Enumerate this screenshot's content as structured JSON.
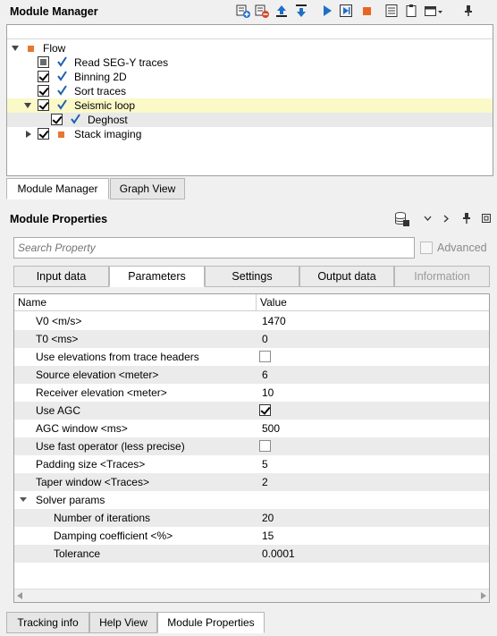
{
  "module_manager": {
    "title": "Module Manager",
    "toolbar_icons": [
      "add-module-icon",
      "remove-module-icon",
      "move-up-icon",
      "move-down-icon",
      "run-icon",
      "run-step-icon",
      "stop-icon",
      "list-icon",
      "clipboard-icon",
      "window-menu-icon",
      "pin-icon"
    ],
    "tree": [
      {
        "label": "Flow"
      },
      {
        "label": "Read SEG-Y traces"
      },
      {
        "label": "Binning 2D"
      },
      {
        "label": "Sort traces"
      },
      {
        "label": "Seismic loop"
      },
      {
        "label": "Deghost"
      },
      {
        "label": "Stack imaging"
      }
    ],
    "tabs": [
      "Module Manager",
      "Graph View"
    ]
  },
  "module_properties": {
    "title": "Module Properties",
    "search_placeholder": "Search Property",
    "advanced_label": "Advanced",
    "tabs": [
      "Input data",
      "Parameters",
      "Settings",
      "Output data",
      "Information"
    ],
    "columns": {
      "name": "Name",
      "value": "Value"
    },
    "rows": [
      {
        "name": "V0 <m/s>",
        "value": "1470"
      },
      {
        "name": "T0 <ms>",
        "value": "0"
      },
      {
        "name": "Use elevations from trace headers",
        "value": ""
      },
      {
        "name": "Source elevation <meter>",
        "value": "6"
      },
      {
        "name": "Receiver elevation <meter>",
        "value": "10"
      },
      {
        "name": "Use AGC",
        "value": ""
      },
      {
        "name": "AGC window <ms>",
        "value": "500"
      },
      {
        "name": "Use fast operator (less precise)",
        "value": ""
      },
      {
        "name": "Padding size <Traces>",
        "value": "5"
      },
      {
        "name": "Taper window <Traces>",
        "value": "2"
      },
      {
        "name": "Solver params",
        "value": ""
      },
      {
        "name": "Number of iterations",
        "value": "20"
      },
      {
        "name": "Damping coefficient <%>",
        "value": "15"
      },
      {
        "name": "Tolerance",
        "value": "0.0001"
      }
    ]
  },
  "bottom_tabs": [
    "Tracking info",
    "Help View",
    "Module Properties"
  ],
  "colors": {
    "flow_marker": "#e67630",
    "check_blue": "#1f5fb0",
    "selected_row": "#fbf9c8"
  }
}
